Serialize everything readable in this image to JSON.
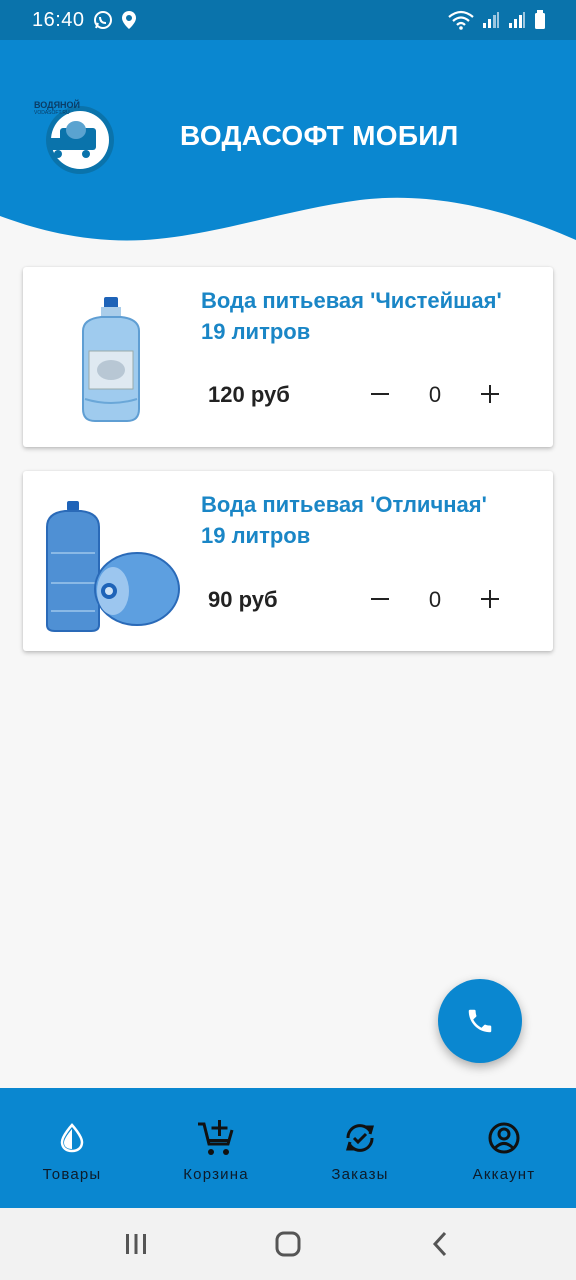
{
  "status_bar": {
    "time": "16:40"
  },
  "header": {
    "title": "ВОДАСОФТ МОБИЛ",
    "logo_text_top": "ВОДЯНОЙ",
    "logo_text_sub": "VODASOFT.RU",
    "bg_color": "#0a87d0"
  },
  "products": [
    {
      "title_line1": "Вода питьевая 'Чистейшая'",
      "title_line2": "19 литров",
      "price": "120 руб",
      "quantity": "0"
    },
    {
      "title_line1": "Вода питьевая 'Отличная'",
      "title_line2": "19 литров",
      "price": "90 руб",
      "quantity": "0"
    }
  ],
  "fab": {
    "icon": "phone-icon"
  },
  "bottom_nav": {
    "items": [
      {
        "label": "Товары",
        "icon": "water-drop-icon"
      },
      {
        "label": "Корзина",
        "icon": "add-to-cart-icon"
      },
      {
        "label": "Заказы",
        "icon": "orders-sync-icon"
      },
      {
        "label": "Аккаунт",
        "icon": "account-circle-icon"
      }
    ]
  },
  "colors": {
    "accent": "#0a87d0",
    "title_blue": "#1a86c6",
    "status_bar": "#0a73ab"
  }
}
